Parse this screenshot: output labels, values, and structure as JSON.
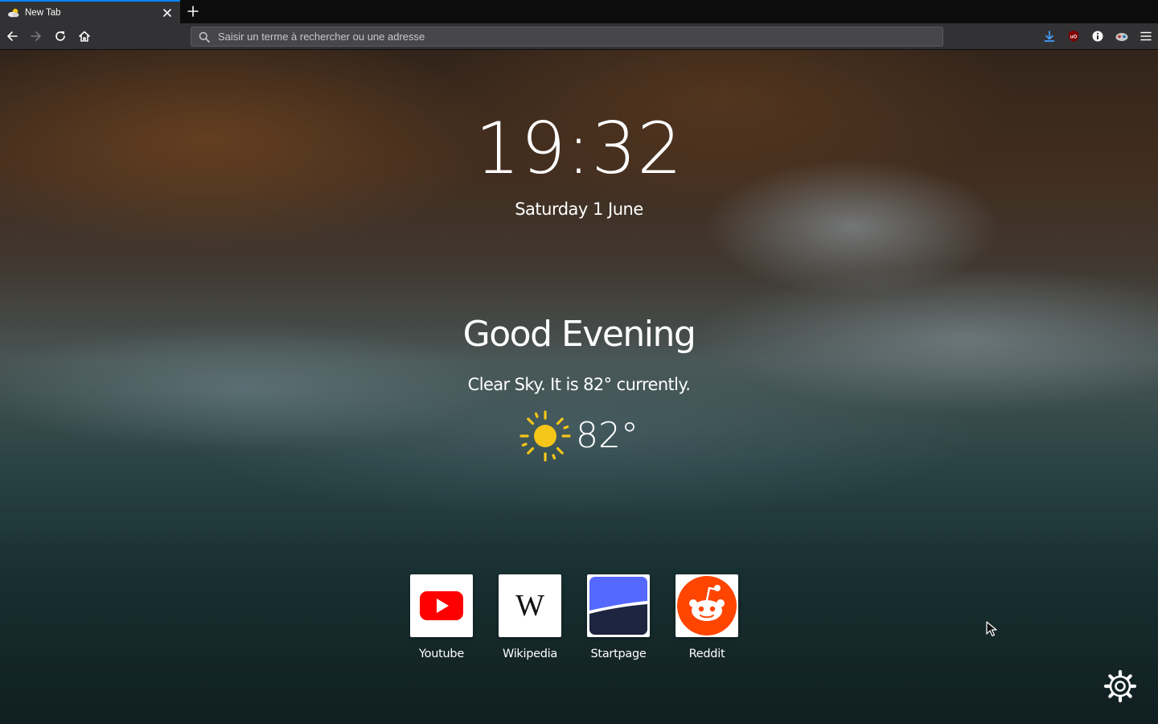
{
  "tab": {
    "title": "New Tab",
    "favicon": "weather-favicon-icon"
  },
  "navbar": {
    "back_icon": "back-arrow-icon",
    "forward_icon": "forward-arrow-icon",
    "reload_icon": "reload-icon",
    "home_icon": "home-icon"
  },
  "urlbar": {
    "placeholder": "Saisir un terme à rechercher ou une adresse",
    "value": ""
  },
  "extensions": [
    "download-icon",
    "ublock-origin-icon",
    "info-icon",
    "privacy-badger-icon",
    "hamburger-menu-icon"
  ],
  "colors": {
    "accent": "#0a84ff",
    "chrome": "#323234",
    "tabstrip": "#0c0c0d",
    "sun": "#f5c518",
    "reddit": "#ff4500",
    "youtube": "#ff0000",
    "startpage": "#5568ff"
  },
  "clock": {
    "time": "19:32",
    "date": "Saturday 1 June"
  },
  "greeting": "Good Evening",
  "weather": {
    "summary": "Clear Sky. It is 82° currently.",
    "temperature": "82°",
    "icon": "sun-icon"
  },
  "shortcuts": [
    {
      "label": "Youtube",
      "icon": "youtube-icon"
    },
    {
      "label": "Wikipedia",
      "icon": "wikipedia-icon",
      "glyph": "W"
    },
    {
      "label": "Startpage",
      "icon": "startpage-icon"
    },
    {
      "label": "Reddit",
      "icon": "reddit-icon"
    }
  ],
  "settings_icon": "gear-icon"
}
